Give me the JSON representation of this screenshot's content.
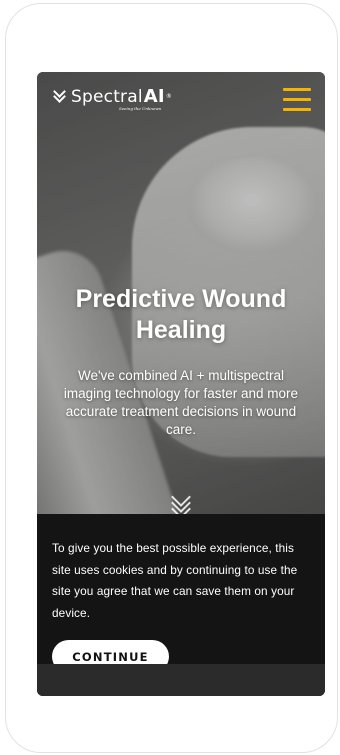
{
  "brand": {
    "logo_name": "Spectral",
    "logo_suffix": "AI",
    "logo_mark": "®",
    "tagline": "Seeing the Unknown",
    "menu_color": "#f5b400"
  },
  "hero": {
    "title": "Predictive Wound Healing",
    "subtitle": "We've combined AI + multispectral imaging technology for faster and more accurate treatment decisions in wound care.",
    "scroll_icon": "chevrons-down-icon"
  },
  "cookie_banner": {
    "message": "To give you the best possible experience, this site uses cookies and by continuing to use the site you agree that we can save them on your device.",
    "button_label": "CONTINUE"
  }
}
